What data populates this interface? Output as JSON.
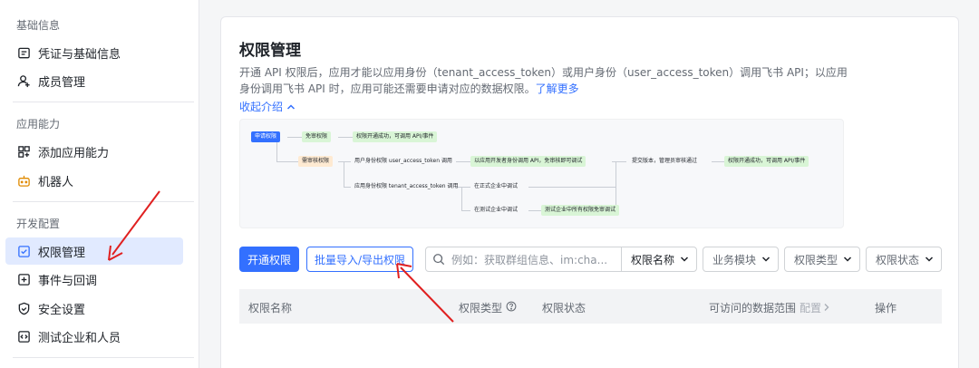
{
  "sidebar": {
    "sections": [
      {
        "title": "基础信息",
        "items": [
          {
            "label": "凭证与基础信息",
            "icon": "credential-icon"
          },
          {
            "label": "成员管理",
            "icon": "member-icon"
          }
        ]
      },
      {
        "title": "应用能力",
        "items": [
          {
            "label": "添加应用能力",
            "icon": "app-grid-icon"
          },
          {
            "label": "机器人",
            "icon": "robot-icon"
          }
        ]
      },
      {
        "title": "开发配置",
        "items": [
          {
            "label": "权限管理",
            "icon": "permission-icon",
            "active": true
          },
          {
            "label": "事件与回调",
            "icon": "event-icon"
          },
          {
            "label": "安全设置",
            "icon": "shield-icon"
          },
          {
            "label": "测试企业和人员",
            "icon": "code-icon"
          }
        ]
      }
    ]
  },
  "main": {
    "title": "权限管理",
    "description": "开通 API 权限后，应用才能以应用身份（tenant_access_token）或用户身份（user_access_token）调用飞书 API；以应用身份调用飞书 API 时，应用可能还需要申请对应的数据权限。",
    "learn_more": "了解更多",
    "collapse_label": "收起介绍",
    "flow": {
      "apply": "申请权限",
      "free": "免审权限",
      "free_result": "权限开通成功，可调用 API/事件",
      "review": "需审核权限",
      "user_identity": "用户身份权限 user_access_token 调用",
      "app_identity": "应用身份权限 tenant_access_token 调用",
      "dev_debug": "以应用开发者身份调用 API，免审核即可调试",
      "submit": "提交版本，管理员审核通过",
      "success": "权限开通成功，可调用 API/事件",
      "formal_debug": "在正式企业中调试",
      "test_debug": "在测试企业中调试",
      "test_result": "测试企业中所有权限免审调试"
    },
    "toolbar": {
      "open_button": "开通权限",
      "batch_button": "批量导入/导出权限",
      "search_placeholder": "例如：获取群组信息、im:cha...",
      "search_field": "权限名称",
      "filters": [
        "业务模块",
        "权限类型",
        "权限状态"
      ]
    },
    "table": {
      "columns": [
        "权限名称",
        "权限类型",
        "权限状态",
        "可访问的数据范围",
        "配置",
        "操作"
      ]
    }
  },
  "colors": {
    "accent": "#3370ff",
    "annotation": "#e02020"
  }
}
